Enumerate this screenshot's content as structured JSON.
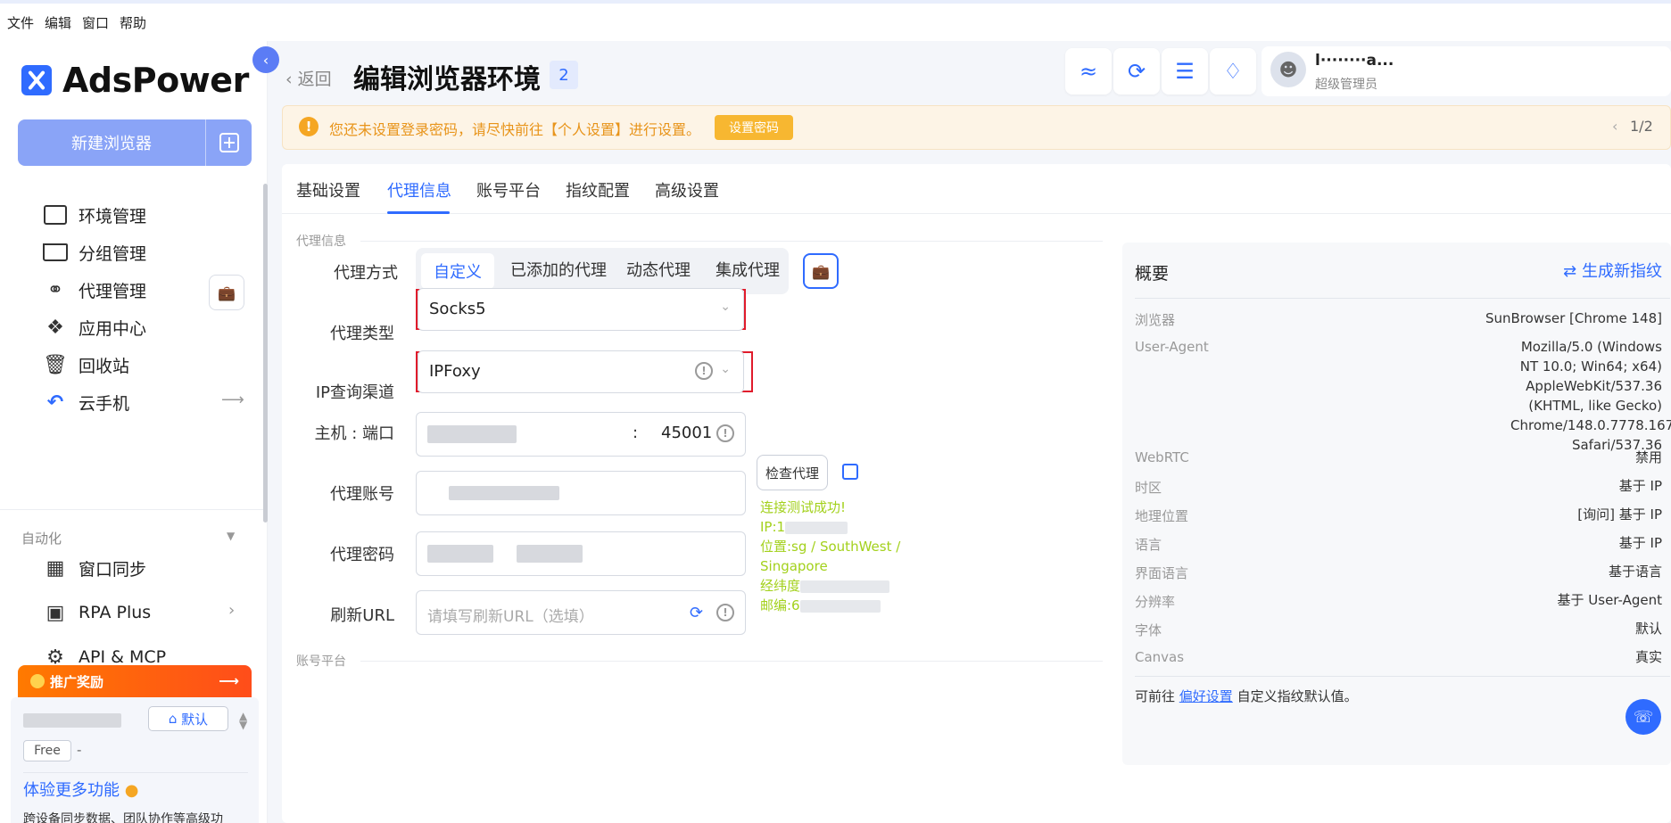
{
  "menubar": [
    "文件",
    "编辑",
    "窗口",
    "帮助"
  ],
  "brand": {
    "name": "AdsPower"
  },
  "sidebar": {
    "new_browser": "新建浏览器",
    "items": [
      {
        "label": "环境管理",
        "icon": "window-icon"
      },
      {
        "label": "分组管理",
        "icon": "folder-icon"
      },
      {
        "label": "代理管理",
        "icon": "proxy-icon"
      },
      {
        "label": "应用中心",
        "icon": "puzzle-icon"
      },
      {
        "label": "回收站",
        "icon": "trash-icon"
      },
      {
        "label": "云手机",
        "icon": "cloud-phone-icon"
      }
    ],
    "automation_section": "自动化",
    "automation_items": [
      {
        "label": "窗口同步",
        "icon": "sync-icon"
      },
      {
        "label": "RPA Plus",
        "icon": "robot-icon"
      },
      {
        "label": "API & MCP",
        "icon": "api-icon"
      }
    ],
    "promo": "推广奖励",
    "account": {
      "default_label": "默认",
      "plan": "Free",
      "plan_suffix": "-"
    },
    "upsell_title": "体验更多功能",
    "upsell_desc": "跨设备同步数据、团队协作等高级功"
  },
  "header": {
    "back": "返回",
    "title": "编辑浏览器环境",
    "badge": "2",
    "user_name": "l········a...",
    "user_role": "超级管理员"
  },
  "notice": {
    "text": "您还未设置登录密码，请尽快前往【个人设置】进行设置。",
    "button": "设置密码",
    "pager": "1/2"
  },
  "tabs": [
    "基础设置",
    "代理信息",
    "账号平台",
    "指纹配置",
    "高级设置"
  ],
  "active_tab": "代理信息",
  "form": {
    "section_title": "代理信息",
    "proxy_method_label": "代理方式",
    "proxy_methods": [
      "自定义",
      "已添加的代理",
      "动态代理",
      "集成代理"
    ],
    "proxy_type_label": "代理类型",
    "proxy_type_value": "Socks5",
    "ip_channel_label": "IP查询渠道",
    "ip_channel_value": "IPFoxy",
    "host_label": "主机 : 端口",
    "host_sep": ":",
    "port": "45001",
    "check_proxy": "检查代理",
    "account_label": "代理账号",
    "password_label": "代理密码",
    "refresh_label": "刷新URL",
    "refresh_placeholder": "请填写刷新URL（选填）",
    "result": {
      "line1": "连接测试成功!",
      "line2": "IP:1",
      "line3": "位置:sg / SouthWest / Singapore",
      "line4": "经纬度",
      "line5": "邮编:6"
    },
    "next_section": "账号平台"
  },
  "overview": {
    "title": "概要",
    "generate": "生成新指纹",
    "rows": [
      {
        "key": "浏览器",
        "value": "SunBrowser [Chrome 148]"
      },
      {
        "key": "User-Agent",
        "value": "Mozilla/5.0 (Windows NT 10.0; Win64; x64) AppleWebKit/537.36 (KHTML, like Gecko) Chrome/148.0.7778.167 Safari/537.36"
      },
      {
        "key": "WebRTC",
        "value": "禁用"
      },
      {
        "key": "时区",
        "value": "基于 IP"
      },
      {
        "key": "地理位置",
        "value": "[询问] 基于 IP"
      },
      {
        "key": "语言",
        "value": "基于 IP"
      },
      {
        "key": "界面语言",
        "value": "基于语言"
      },
      {
        "key": "分辨率",
        "value": "基于 User-Agent"
      },
      {
        "key": "字体",
        "value": "默认"
      },
      {
        "key": "Canvas",
        "value": "真实"
      }
    ],
    "footer_prefix": "可前往",
    "footer_link": "偏好设置",
    "footer_suffix": "自定义指纹默认值。"
  },
  "colors": {
    "accent": "#2f6bff",
    "warning": "#f5a623",
    "success": "#a3d11c",
    "highlight": "#e01b2b"
  }
}
